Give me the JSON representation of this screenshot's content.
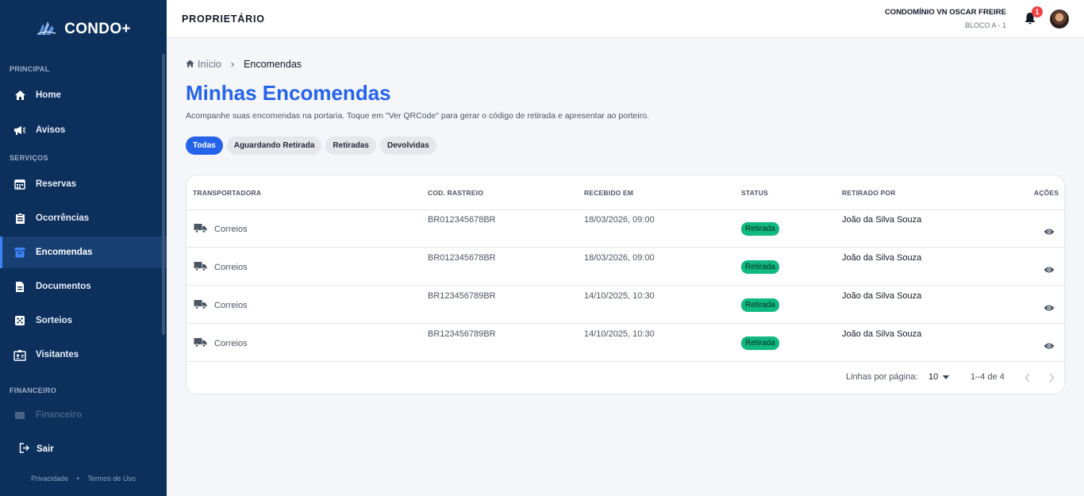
{
  "app": {
    "brand": "CONDO+"
  },
  "sidebar": {
    "sections": {
      "principal": "PRINCIPAL",
      "servicos": "SERVIÇOS",
      "financeiro": "FINANCEIRO"
    },
    "items": [
      {
        "label": "Home",
        "icon": "home-icon"
      },
      {
        "label": "Avisos",
        "icon": "megaphone-icon"
      },
      {
        "label": "Reservas",
        "icon": "calendar-icon"
      },
      {
        "label": "Ocorrências",
        "icon": "clipboard-icon"
      },
      {
        "label": "Encomendas",
        "icon": "archive-box-icon"
      },
      {
        "label": "Documentos",
        "icon": "document-icon"
      },
      {
        "label": "Sorteios",
        "icon": "dice-icon"
      },
      {
        "label": "Visitantes",
        "icon": "visitor-badge-icon"
      }
    ],
    "financeiro_item": "Financeiro",
    "logout": "Sair",
    "footer": {
      "privacy": "Privacidade",
      "dot": "•",
      "terms": "Termos de Uso"
    },
    "active_color": "#3b82f6",
    "background": "#0c2f5c"
  },
  "topbar": {
    "title": "PROPRIETÁRIO",
    "condo_name": "CONDOMÍNIO VN OSCAR FREIRE",
    "condo_unit": "BLOCO A - 1",
    "notification_count": "1"
  },
  "breadcrumb": {
    "home": "Início",
    "separator": "›",
    "current": "Encomendas"
  },
  "page": {
    "title": "Minhas Encomendas",
    "description": "Acompanhe suas encomendas na portaria. Toque em \"Ver QRCode\" para gerar o código de retirada e apresentar ao porteiro."
  },
  "filters": [
    {
      "label": "Todas",
      "active": true
    },
    {
      "label": "Aguardando Retirada",
      "active": false
    },
    {
      "label": "Retiradas",
      "active": false
    },
    {
      "label": "Devolvidas",
      "active": false
    }
  ],
  "table": {
    "headers": {
      "carrier": "TRANSPORTADORA",
      "code": "COD. RASTREIO",
      "received": "RECEBIDO EM",
      "status": "STATUS",
      "picked_by": "RETIRADO POR",
      "actions": "AÇÕES"
    },
    "rows": [
      {
        "carrier": "Correios",
        "code": "BR012345678BR",
        "received": "18/03/2026, 09:00",
        "status": "Retirada",
        "picked_by": "João da Silva Souza"
      },
      {
        "carrier": "Correios",
        "code": "BR012345678BR",
        "received": "18/03/2026, 09:00",
        "status": "Retirada",
        "picked_by": "João da Silva Souza"
      },
      {
        "carrier": "Correios",
        "code": "BR123456789BR",
        "received": "14/10/2025, 10:30",
        "status": "Retirada",
        "picked_by": "João da Silva Souza"
      },
      {
        "carrier": "Correios",
        "code": "BR123456789BR",
        "received": "14/10/2025, 10:30",
        "status": "Retirada",
        "picked_by": "João da Silva Souza"
      }
    ],
    "status_color": "#10b981"
  },
  "pagination": {
    "rows_per_page_label": "Linhas por página:",
    "rows_per_page": "10",
    "range": "1–4 de 4"
  },
  "accent": "#2563eb"
}
